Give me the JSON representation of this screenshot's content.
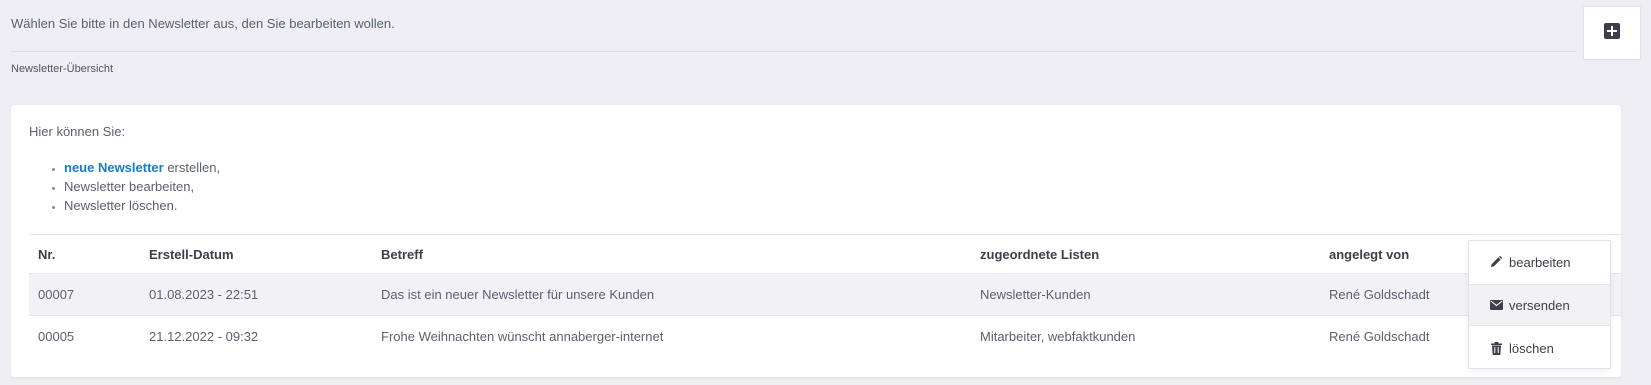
{
  "header": {
    "intro": "Wählen Sie bitte in den Newsletter aus, den Sie bearbeiten wollen.",
    "breadcrumb": "Newsletter-Übersicht",
    "add_icon": "plus-square-icon"
  },
  "card": {
    "lead": "Hier können Sie:",
    "bullets": {
      "b1_link": "neue Newsletter",
      "b1_rest": " erstellen,",
      "b2": "Newsletter bearbeiten,",
      "b3": "Newsletter löschen."
    }
  },
  "table": {
    "headers": {
      "nr": "Nr.",
      "date": "Erstell-Datum",
      "subject": "Betreff",
      "lists": "zugeordnete Listen",
      "user": "angelegt von"
    },
    "rows": [
      {
        "nr": "00007",
        "date": "01.08.2023 - 22:51",
        "subject": "Das ist ein neuer Newsletter für unsere Kunden",
        "lists": "Newsletter-Kunden",
        "user": "René Goldschadt"
      },
      {
        "nr": "00005",
        "date": "21.12.2022 - 09:32",
        "subject": "Frohe Weihnachten wünscht annaberger-internet",
        "lists": "Mitarbeiter, webfaktkunden",
        "user": "René Goldschadt"
      }
    ]
  },
  "actions": {
    "edit": "bearbeiten",
    "send": "versenden",
    "delete": "löschen",
    "icons": [
      "pencil-icon",
      "envelope-icon",
      "trash-icon"
    ]
  },
  "colors": {
    "background": "#eeeef4",
    "link": "#1a7cc4",
    "text": "#5c6070",
    "row_alt": "#f2f2f6"
  }
}
